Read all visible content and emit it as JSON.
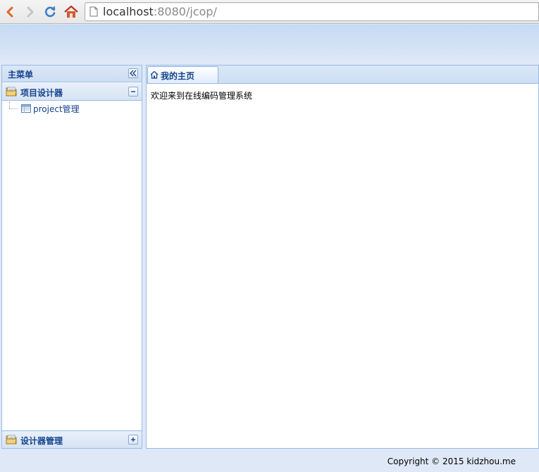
{
  "browser": {
    "url_host": "localhost",
    "url_rest": ":8080/jcop/",
    "icons": [
      "back-icon",
      "forward-icon",
      "reload-icon",
      "home-icon",
      "page-icon"
    ]
  },
  "sidebar": {
    "title": "主菜单",
    "sections": [
      {
        "title": "项目设计器",
        "expanded": true,
        "items": [
          {
            "label": "project管理"
          }
        ]
      },
      {
        "title": "设计器管理",
        "expanded": false
      }
    ]
  },
  "tabs": [
    {
      "label": "我的主页",
      "active": true
    }
  ],
  "main": {
    "welcome_text": "欢迎来到在线编码管理系统"
  },
  "footer": {
    "copyright": "Copyright © 2015 kidzhou.me"
  },
  "colors": {
    "accent": "#15428b",
    "border": "#99bbe8",
    "background": "#dfe8f6"
  }
}
